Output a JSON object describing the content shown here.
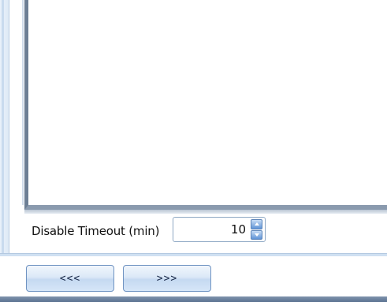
{
  "timeout": {
    "label": "Disable Timeout (min)",
    "value": "10"
  },
  "navigation": {
    "prev_label": "<<<",
    "next_label": ">>>"
  },
  "icons": {
    "spin_up": "chevron-up-icon",
    "spin_down": "chevron-down-icon"
  },
  "colors": {
    "panel_border": "#6d7f95",
    "button_border": "#6f93c2",
    "spinner_accent": "#5f93d6"
  }
}
